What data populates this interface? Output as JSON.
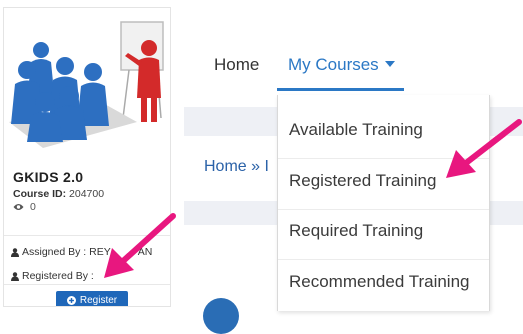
{
  "course_card": {
    "title": "GKIDS 2.0",
    "course_id_label": "Course ID:",
    "course_id_value": "204700",
    "views": "0",
    "assigned_by": "Assigned By : REY",
    "assigned_by_tail": "AN",
    "registered_by": "Registered By :",
    "register_button": "Register",
    "icons": [
      "eye-icon",
      "user-icon",
      "plus-circle-icon"
    ]
  },
  "nav": {
    "home": "Home",
    "my_courses": "My Courses",
    "accent_color": "#2b78c5"
  },
  "breadcrumb": {
    "home": "Home",
    "separator": "»",
    "next_partial": "I"
  },
  "dropdown": {
    "items": [
      {
        "label": "Available Training"
      },
      {
        "label": "Registered Training"
      },
      {
        "label": "Required Training"
      },
      {
        "label": "Recommended Training"
      }
    ]
  },
  "colors": {
    "arrow": "#e8177f",
    "button": "#1f67b9",
    "link": "#2b62a8"
  }
}
